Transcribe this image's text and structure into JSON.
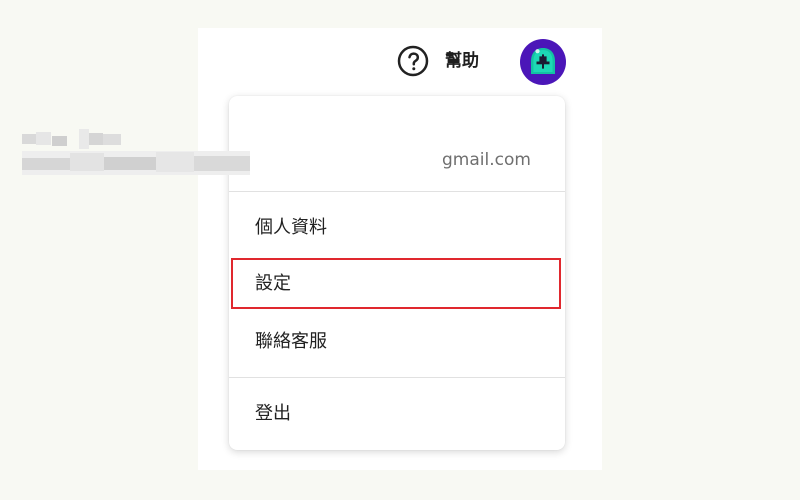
{
  "header": {
    "help_label": "幫助",
    "help_icon": "help-circle-icon",
    "avatar_icon": "knight-helmet-avatar-icon"
  },
  "user": {
    "email_suffix": "gmail.com"
  },
  "menu": {
    "items": [
      {
        "label": "個人資料"
      },
      {
        "label": "設定",
        "highlighted": true
      },
      {
        "label": "聯絡客服"
      },
      {
        "label": "登出"
      }
    ]
  },
  "colors": {
    "background": "#f8f9f3",
    "panel": "#ffffff",
    "highlight_border": "#e0282e",
    "avatar_purple": "#4b16b8",
    "avatar_green": "#13c2a3"
  }
}
